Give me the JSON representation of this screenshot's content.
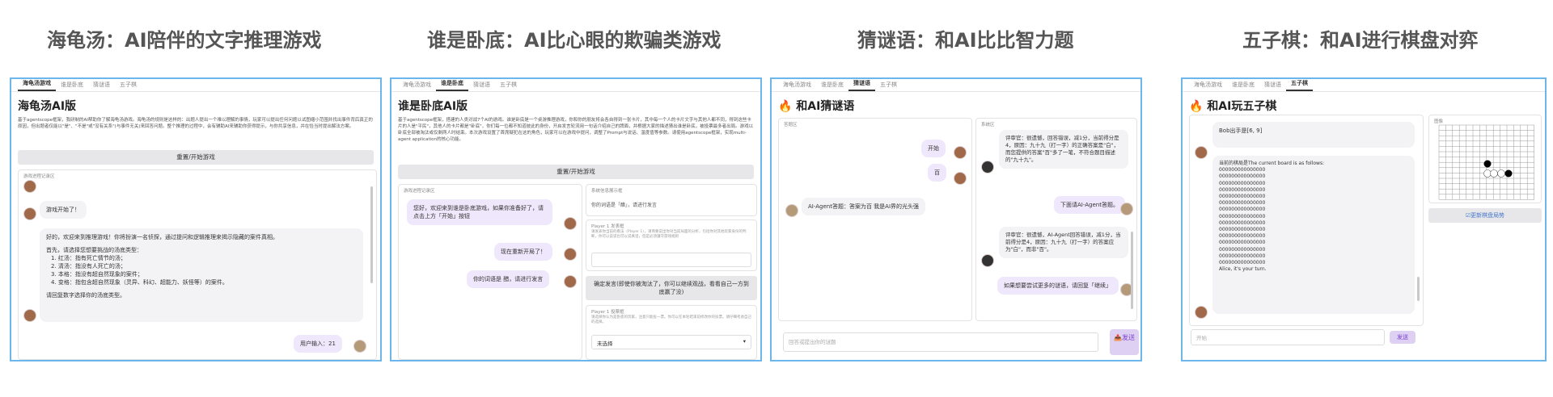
{
  "titles": [
    "海龟汤：AI陪伴的文字推理游戏",
    "谁是卧底：AI比心眼的欺骗类游戏",
    "猜谜语：和AI比比智力题",
    "五子棋：和AI进行棋盘对弈"
  ],
  "tabs": [
    "海龟汤游戏",
    "谁是卧底",
    "猜谜语",
    "五子棋"
  ],
  "p1": {
    "heading": "海龟汤AI版",
    "desc": "基于agentscope框架，我研制的AI帮助你了解海龟汤游戏。海龟汤的规则是这样的：出题人提出一个难以理解的事情，玩家可以提出任何问题以试图缩小范围并找出事件背后真正的原因，但出题者仅能以\"是\"、\"不是\"或\"没有关系\"(与事件无关)来回答问题。整个推理的过程中，会有辅助AI来辅助你获得提示，与你共享信息，并在恰当时提出解法方案。",
    "restart": "重置/开始游戏",
    "chat_label": "游戏进程记录区",
    "msg1": "游戏开始了！",
    "msg2a": "好的，欢迎来到推理游戏！你将扮演一名侦探，通过提问和逻辑推理来揭示隐藏的案件真相。",
    "msg2b": "首先，请选择您想要挑战的汤底类型：",
    "msg2c": [
      "1. 红汤：指有死亡情节的汤；",
      "2. 清汤：指没有人死亡的汤；",
      "3. 本格：指没有超自然现象的案件；",
      "4. 变格：指包含超自然现象（灵异、科幻、超能力、妖怪等）的案件。"
    ],
    "msg2d": "请回复数字选择你的汤底类型。",
    "user": "用户输入：21"
  },
  "p2": {
    "heading": "谁是卧底AI版",
    "desc": "基于agentscope框架，搭建的人类对战7个AI的游戏。谁是卧底是一个桌游推理游戏，你和你的朋友将会各自得到一张卡片，其中每一个人的卡片文字与其他人都不同，得到这些卡片的人是\"平民\"，其他人的卡片都是\"卧底\"，你们每一位都不知道彼此的身份，开启发言轮流用一句话介绍自己的牌面，并根据大家的描述猜出谁是卧底，被投票最多者出局。游戏以卧底全部被淘汰或仅剩两人时结束。本次游戏设置了首席疑犯在这的角色，玩家可以在游戏中提问，调整了Prompt与说话、温度值等参数。请使用agentscope框架，实现multi-agent application的核心功能。",
    "restart": "重置/开始游戏",
    "chat_label": "游戏进程记录区",
    "m1": "您好，欢迎来到谁是卧底游戏，如果你准备好了，请点击上方「开始」按钮",
    "m2": "现在重新开局了！",
    "m3": "你的词语是 醋，请进行发言",
    "sys_label": "系统信息展示框",
    "sys_text": "你的词语是「醋」，请进行发言",
    "p1_label": "Player 1 发表框",
    "p1_hint": "请发表你当前的看法（Player 1），请简要说出你对当前局面的分析，包括你对其他玩家身份的判断，你可以说谎也可以说真话，但是必须遵守游戏规则",
    "confirm": "确定发言(即使你被淘汰了，你可以继续观战，看看自己一方到底赢了没)",
    "vote_label": "Player 1 投票框",
    "vote_hint": "请选择你认为是卧底的玩家，注意只能投一票。你可以在本轮结束前修改你的投票。请仔细考虑自己的选择。",
    "vote_value": "未选择"
  },
  "p3": {
    "heading": "🔥 和AI猜谜语",
    "left_label": "答题区",
    "right_label": "系统区",
    "start": "开始",
    "hundred": "百",
    "agent_ans": "AI-Agent答题：答案为百 我是AI界的光头强",
    "judge1": "评审官：很遗憾，回答错误，减1分，当前得分是4，原因：九十九（打一字）的正确答案是\"白\"，而您提供的答案\"百\"多了一笔，不符合题目描述的\"九十九\"。",
    "next": "下面请AI-Agent答题。",
    "judge2": "评审官：很遗憾，AI-Agent回答错误，减1分，当前得分是4，原因：九十九（打一字）的答案应为\"白\"，而非\"百\"。",
    "more": "如果想要尝试更多的谜语，请回复「继续」",
    "input_ph": "回答或提出你的谜题",
    "send": "📤发送"
  },
  "p4": {
    "heading": "🔥 和AI玩五子棋",
    "msg1": "Bob出手是[6, 9]",
    "board_intro": "当前的棋局是The current board is as follows:",
    "rows": [
      "000000000000000",
      "000000000000000",
      "000000000000000",
      "000000000000000",
      "000000000000000",
      "000000000000000",
      "000000000000000",
      "000000000000000",
      "000000000000000",
      "000000000000000",
      "000000000000000",
      "000000000000000",
      "000000000000000",
      "000000000000000",
      "000000000000000"
    ],
    "turn": "Alice, it's your turn.",
    "img_label": "图像",
    "update": "☑更新棋盘局势",
    "input_ph": "开始",
    "send": "发送"
  },
  "colors": {
    "border": "#6cb6ec",
    "accent": "#7b3fd1",
    "bubble_me": "#efe7fb"
  }
}
